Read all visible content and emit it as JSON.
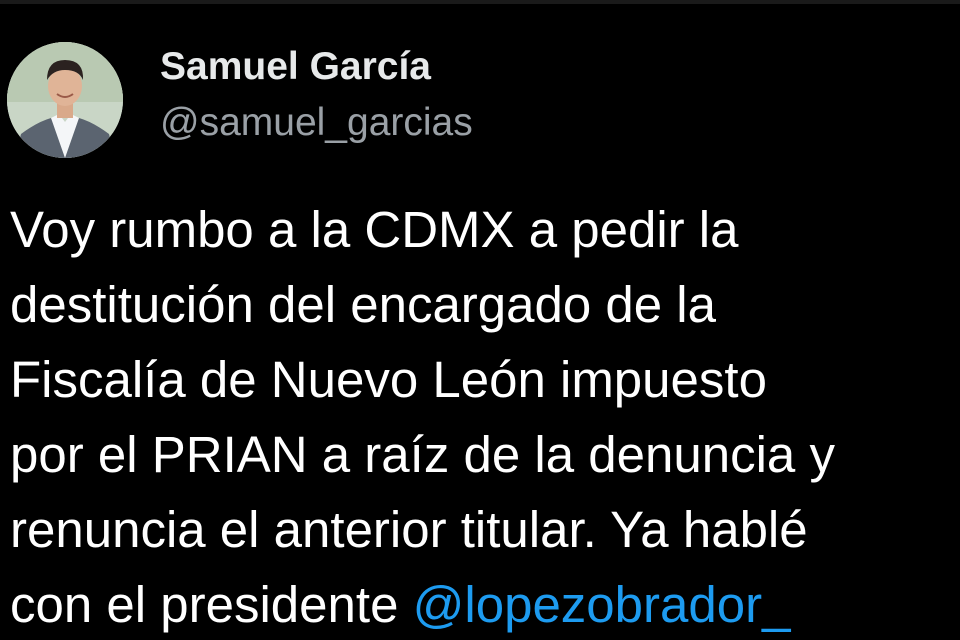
{
  "author": {
    "display_name": "Samuel García",
    "handle": "@samuel_garcias"
  },
  "tweet": {
    "lines": [
      "Voy rumbo a la CDMX a pedir la",
      "destitución del encargado de la",
      "Fiscalía de Nuevo León impuesto",
      "por el PRIAN a raíz de la denuncia y",
      "renuncia el anterior titular. Ya hablé"
    ],
    "last_line_text": "con el presidente ",
    "mention": "@lopezobrador_"
  },
  "colors": {
    "background": "#000000",
    "text": "#ffffff",
    "handle": "#9aa0a6",
    "mention": "#1d9bf0"
  }
}
